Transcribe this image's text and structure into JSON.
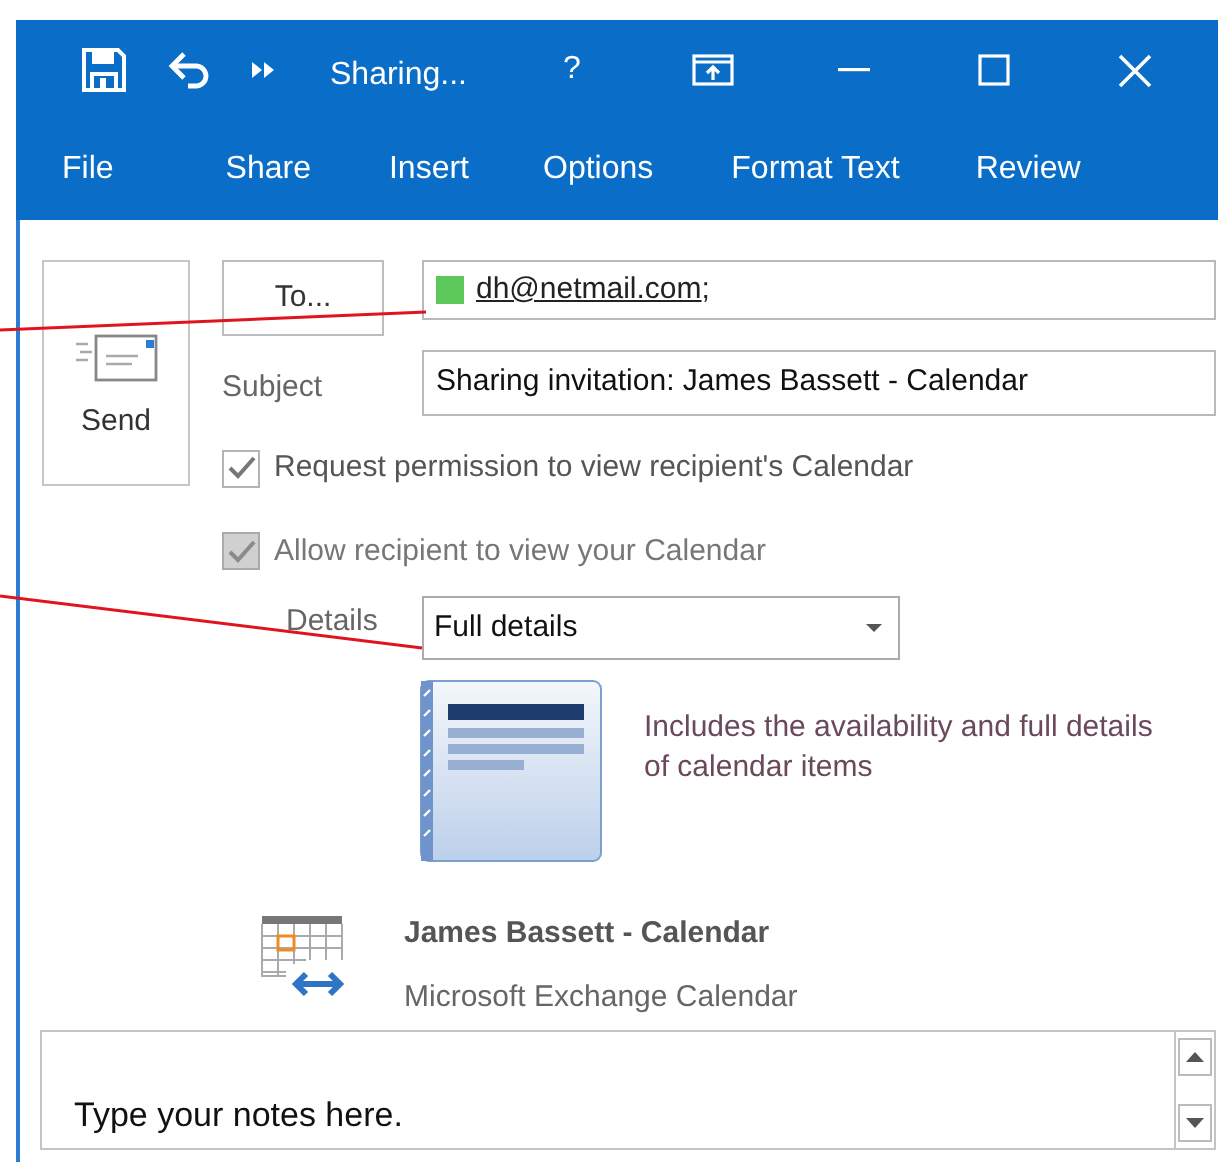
{
  "window": {
    "title": "Sharing...",
    "help": "?"
  },
  "ribbon_tabs": [
    {
      "label": "File"
    },
    {
      "label": "Share"
    },
    {
      "label": "Insert"
    },
    {
      "label": "Options"
    },
    {
      "label": "Format Text"
    },
    {
      "label": "Review"
    }
  ],
  "send_button": {
    "label": "Send"
  },
  "to_button": {
    "label": "To..."
  },
  "recipients": [
    {
      "address": "dh@netmail.com",
      "separator": ";",
      "color": "#5cc85a"
    }
  ],
  "subject": {
    "label": "Subject",
    "value": "Sharing invitation: James Bassett - Calendar"
  },
  "options": [
    {
      "label": "Request permission to view recipient's Calendar",
      "checked": true,
      "disabled": false
    },
    {
      "label": "Allow recipient to view your Calendar",
      "checked": true,
      "disabled": true
    }
  ],
  "details": {
    "label": "Details",
    "value": "Full details",
    "description": "Includes the availability and full details of calendar items"
  },
  "calendar": {
    "name": "James Bassett - Calendar",
    "type": "Microsoft Exchange Calendar"
  },
  "notes": {
    "placeholder": "Type your notes here."
  }
}
